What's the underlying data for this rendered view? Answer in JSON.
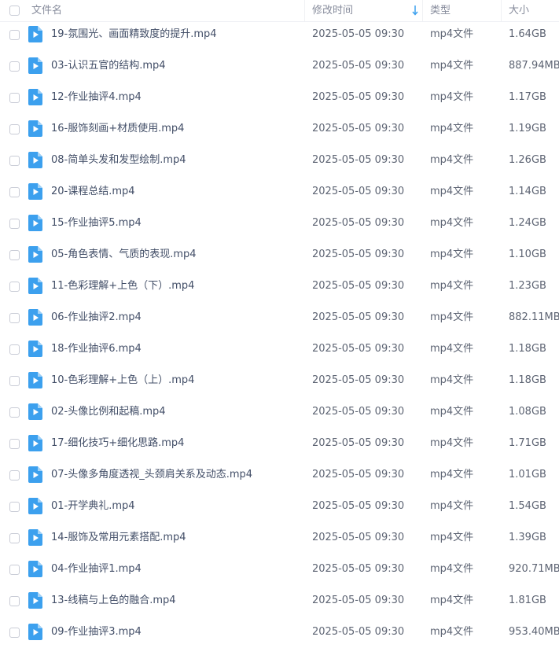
{
  "columns": {
    "name": "文件名",
    "modified": "修改时间",
    "type": "类型",
    "size": "大小"
  },
  "accent_color": "#3ca0ee",
  "files": [
    {
      "name": "19-氛围光、画面精致度的提升.mp4",
      "modified": "2025-05-05 09:30",
      "type": "mp4文件",
      "size": "1.64GB"
    },
    {
      "name": "03-认识五官的结构.mp4",
      "modified": "2025-05-05 09:30",
      "type": "mp4文件",
      "size": "887.94MB"
    },
    {
      "name": "12-作业抽评4.mp4",
      "modified": "2025-05-05 09:30",
      "type": "mp4文件",
      "size": "1.17GB"
    },
    {
      "name": "16-服饰刻画+材质使用.mp4",
      "modified": "2025-05-05 09:30",
      "type": "mp4文件",
      "size": "1.19GB"
    },
    {
      "name": "08-简单头发和发型绘制.mp4",
      "modified": "2025-05-05 09:30",
      "type": "mp4文件",
      "size": "1.26GB"
    },
    {
      "name": "20-课程总结.mp4",
      "modified": "2025-05-05 09:30",
      "type": "mp4文件",
      "size": "1.14GB"
    },
    {
      "name": "15-作业抽评5.mp4",
      "modified": "2025-05-05 09:30",
      "type": "mp4文件",
      "size": "1.24GB"
    },
    {
      "name": "05-角色表情、气质的表现.mp4",
      "modified": "2025-05-05 09:30",
      "type": "mp4文件",
      "size": "1.10GB"
    },
    {
      "name": "11-色彩理解+上色（下）.mp4",
      "modified": "2025-05-05 09:30",
      "type": "mp4文件",
      "size": "1.23GB"
    },
    {
      "name": "06-作业抽评2.mp4",
      "modified": "2025-05-05 09:30",
      "type": "mp4文件",
      "size": "882.11MB"
    },
    {
      "name": "18-作业抽评6.mp4",
      "modified": "2025-05-05 09:30",
      "type": "mp4文件",
      "size": "1.18GB"
    },
    {
      "name": "10-色彩理解+上色（上）.mp4",
      "modified": "2025-05-05 09:30",
      "type": "mp4文件",
      "size": "1.18GB"
    },
    {
      "name": "02-头像比例和起稿.mp4",
      "modified": "2025-05-05 09:30",
      "type": "mp4文件",
      "size": "1.08GB"
    },
    {
      "name": "17-细化技巧+细化思路.mp4",
      "modified": "2025-05-05 09:30",
      "type": "mp4文件",
      "size": "1.71GB"
    },
    {
      "name": "07-头像多角度透视_头颈肩关系及动态.mp4",
      "modified": "2025-05-05 09:30",
      "type": "mp4文件",
      "size": "1.01GB"
    },
    {
      "name": "01-开学典礼.mp4",
      "modified": "2025-05-05 09:30",
      "type": "mp4文件",
      "size": "1.54GB"
    },
    {
      "name": "14-服饰及常用元素搭配.mp4",
      "modified": "2025-05-05 09:30",
      "type": "mp4文件",
      "size": "1.39GB"
    },
    {
      "name": "04-作业抽评1.mp4",
      "modified": "2025-05-05 09:30",
      "type": "mp4文件",
      "size": "920.71MB"
    },
    {
      "name": "13-线稿与上色的融合.mp4",
      "modified": "2025-05-05 09:30",
      "type": "mp4文件",
      "size": "1.81GB"
    },
    {
      "name": "09-作业抽评3.mp4",
      "modified": "2025-05-05 09:30",
      "type": "mp4文件",
      "size": "953.40MB"
    }
  ]
}
